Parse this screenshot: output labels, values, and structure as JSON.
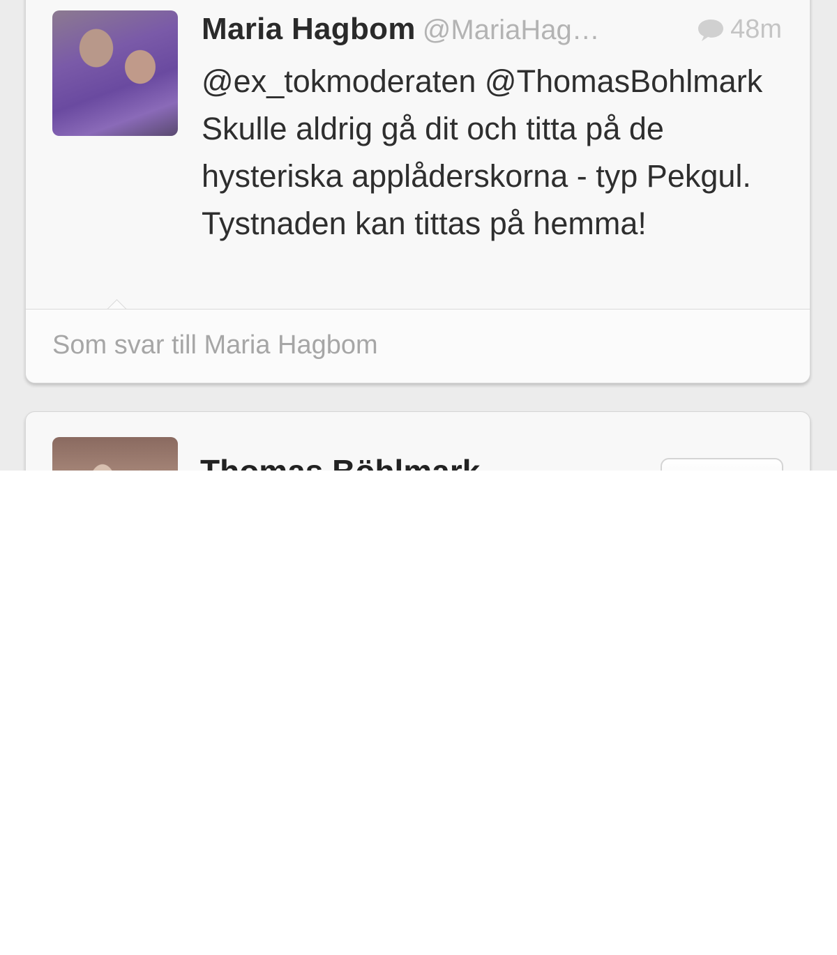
{
  "tweet": {
    "author_name": "Maria Hagbom",
    "author_handle": "@MariaHag…",
    "time": "48m",
    "text": "@ex_tokmoderaten @ThomasBohlmark Skulle aldrig gå dit och titta på de hysteriska applåderskorna - typ Pekgul. Tystnaden kan tittas på hemma!",
    "reply_context": "Som svar till Maria Hagbom"
  },
  "next_tweet": {
    "author_name": "Thomas Böhlmark"
  },
  "icons": {
    "reply_indicator": "speech-bubble-icon"
  },
  "colors": {
    "background": "#ececec",
    "card": "#f8f8f8",
    "muted_text": "#b3b3b3",
    "text": "#2e2e2e"
  }
}
